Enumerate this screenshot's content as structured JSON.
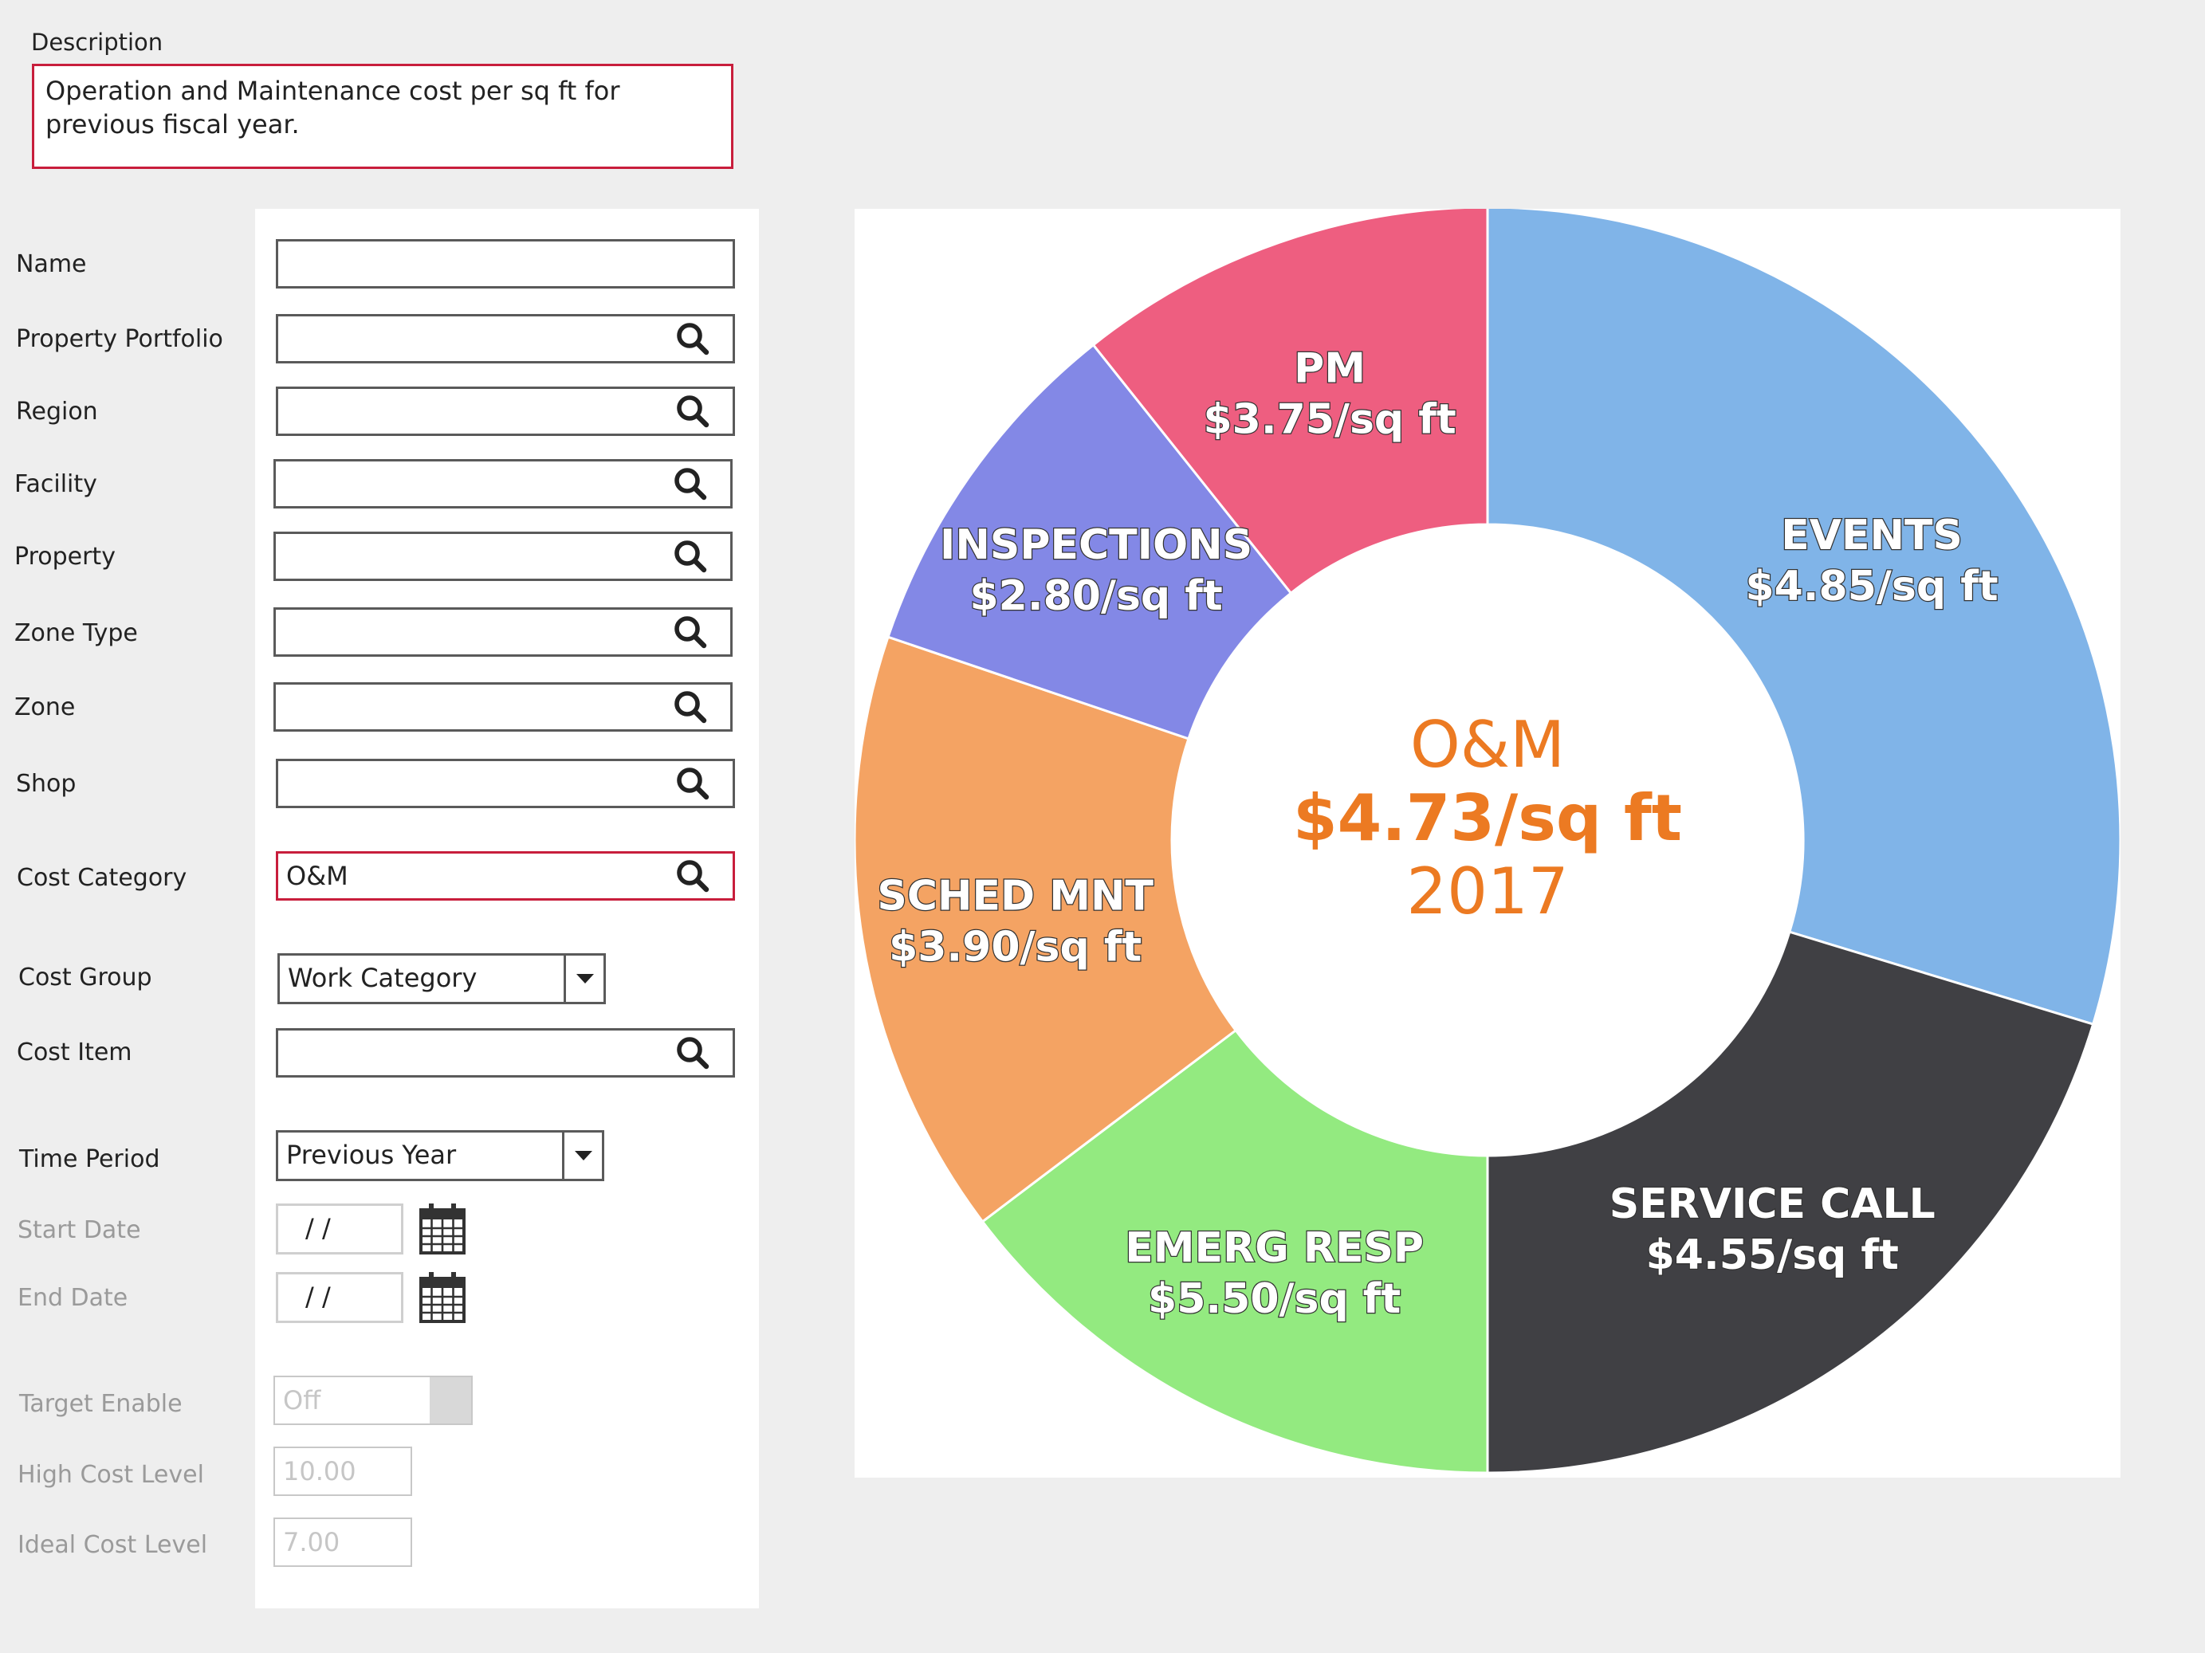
{
  "description": {
    "label": "Description",
    "text": "Operation and Maintenance cost per sq ft for previous fiscal year."
  },
  "form": {
    "name": {
      "label": "Name",
      "value": ""
    },
    "property_portfolio": {
      "label": "Property Portfolio",
      "value": ""
    },
    "region": {
      "label": "Region",
      "value": ""
    },
    "facility": {
      "label": "Facility",
      "value": ""
    },
    "property": {
      "label": "Property",
      "value": ""
    },
    "zone_type": {
      "label": "Zone Type",
      "value": ""
    },
    "zone": {
      "label": "Zone",
      "value": ""
    },
    "shop": {
      "label": "Shop",
      "value": ""
    },
    "cost_category": {
      "label": "Cost Category",
      "value": "O&M"
    },
    "cost_group": {
      "label": "Cost Group",
      "value": "Work Category"
    },
    "cost_item": {
      "label": "Cost Item",
      "value": ""
    },
    "time_period": {
      "label": "Time Period",
      "value": "Previous Year"
    },
    "start_date": {
      "label": "Start Date",
      "value": " /  /"
    },
    "end_date": {
      "label": "End Date",
      "value": " /  /"
    },
    "target_enable": {
      "label": "Target Enable",
      "value": "Off"
    },
    "high_cost_level": {
      "label": "High Cost Level",
      "value": "10.00"
    },
    "ideal_cost_level": {
      "label": "Ideal Cost Level",
      "value": "7.00"
    }
  },
  "icons": {
    "lookup": "magnifier-icon",
    "dropdown": "triangle-down-icon",
    "date_picker": "calendar-icon"
  },
  "colors": {
    "required_border": "#c81e3c",
    "center_text": "#ec7a22"
  },
  "chart_data": {
    "type": "pie",
    "donut": true,
    "center_text": [
      "O&M",
      "$4.73/sq ft",
      "2017"
    ],
    "categories": [
      "EVENTS",
      "SERVICE CALL",
      "EMERG RESP",
      "SCHED MNT",
      "INSPECTIONS",
      "PM"
    ],
    "values": [
      4.85,
      4.55,
      5.5,
      3.9,
      2.8,
      3.75
    ],
    "value_labels": [
      "$4.85/sq ft",
      "$4.55/sq ft",
      "$5.50/sq ft",
      "$3.90/sq ft",
      "$2.80/sq ft",
      "$3.75/sq ft"
    ],
    "slice_fractions": [
      0.297,
      0.203,
      0.147,
      0.155,
      0.091,
      0.107
    ],
    "colors": [
      "#80b4e8",
      "#404044",
      "#93ea80",
      "#f4a363",
      "#8388e6",
      "#ee5e80"
    ]
  }
}
